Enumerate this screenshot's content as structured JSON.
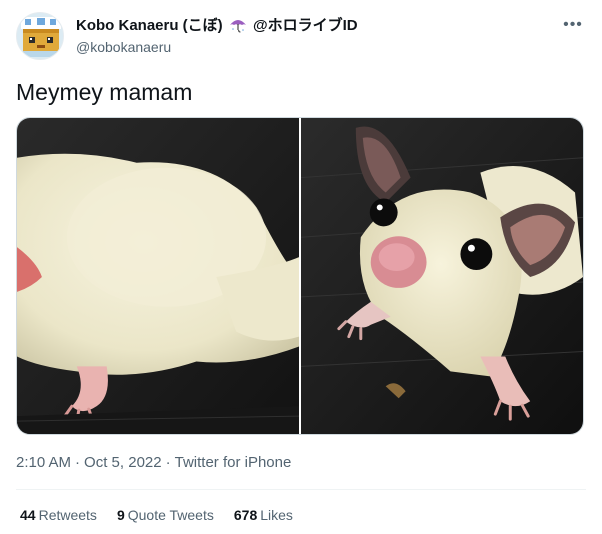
{
  "tweet": {
    "author": {
      "name_prefix": "Kobo Kanaeru (こぼ)",
      "name_suffix": "@ホロライブID",
      "handle": "@kobokanaeru",
      "avatar_icon": "avatar-icon",
      "badge_icon": "umbrella-icon"
    },
    "more_label": "•••",
    "text": "Meymey mamam",
    "time": "2:10 AM",
    "date": "Oct 5, 2022",
    "separator": "·",
    "source": "Twitter for iPhone",
    "stats": {
      "retweets_count": "44",
      "retweets_label": "Retweets",
      "quotes_count": "9",
      "quotes_label": "Quote Tweets",
      "likes_count": "678",
      "likes_label": "Likes"
    }
  },
  "colors": {
    "text_primary": "#0f1419",
    "text_secondary": "#536471",
    "border": "#cfd9de",
    "divider": "#eff3f4",
    "umbrella": "#9b5fc0"
  }
}
